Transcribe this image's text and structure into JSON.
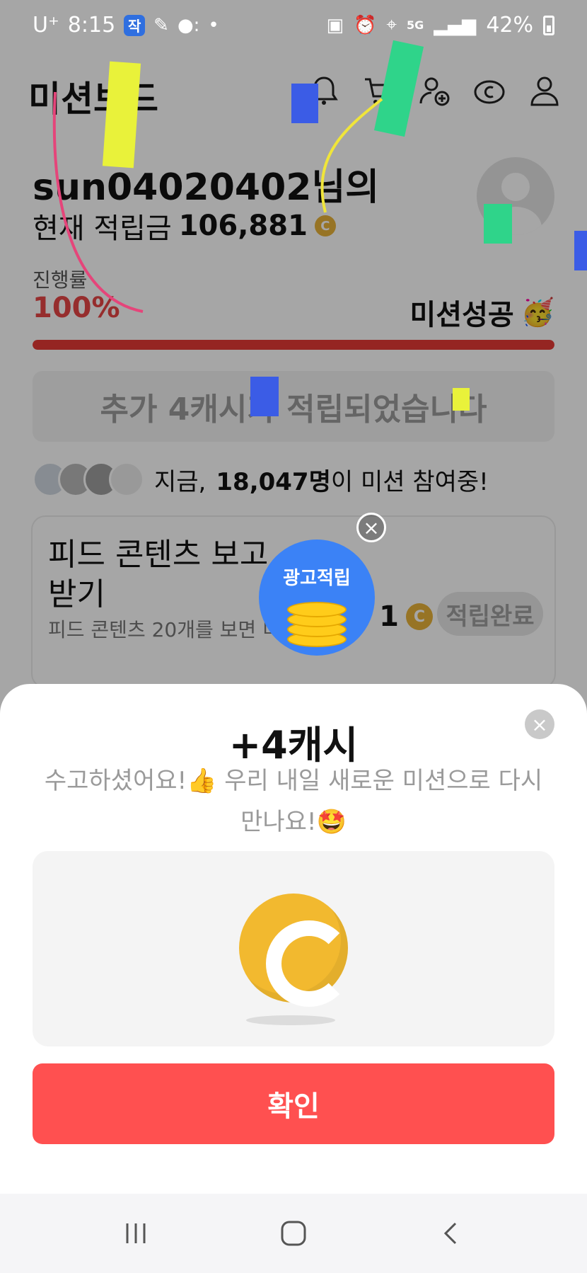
{
  "status_bar": {
    "carrier": "U⁺",
    "time": "8:15",
    "app_icon_label": "작",
    "network": "5G",
    "battery": "42%"
  },
  "header": {
    "brand": "미션보드",
    "icons": [
      "bell-icon",
      "cart-icon",
      "add-user-icon",
      "coin-icon",
      "profile-icon"
    ]
  },
  "user": {
    "name": "sun04020402님의",
    "savings_label": "현재 적립금",
    "savings_value": "106,881",
    "coin_symbol": "C"
  },
  "progress": {
    "label": "진행률",
    "value_text": "100%",
    "fraction": 1.0,
    "status": "미션성공",
    "status_emoji": "🥳"
  },
  "banner": {
    "text": "추가 4캐시가 적립되었습니다"
  },
  "participants": {
    "prefix": "지금,",
    "count": "18,047명",
    "suffix": "이 미션 참여중!"
  },
  "feed_card": {
    "title": "피드 콘텐츠 보고 받기",
    "description": "피드 콘텐츠 20개를 보면 미션이",
    "reward": "1",
    "button": "적립완료"
  },
  "ad_bubble": {
    "label": "광고적립"
  },
  "sheet": {
    "title": "+4캐시",
    "message_line1": "수고하셨어요!👍 우리 내일 새로운 미션으로 다시",
    "message_line2": "만나요!🤩",
    "confirm_label": "확인"
  },
  "colors": {
    "accent_red": "#ff5050",
    "progress_red": "#e53935",
    "coin_gold": "#f2b92f",
    "ad_blue": "#3b82f6"
  }
}
